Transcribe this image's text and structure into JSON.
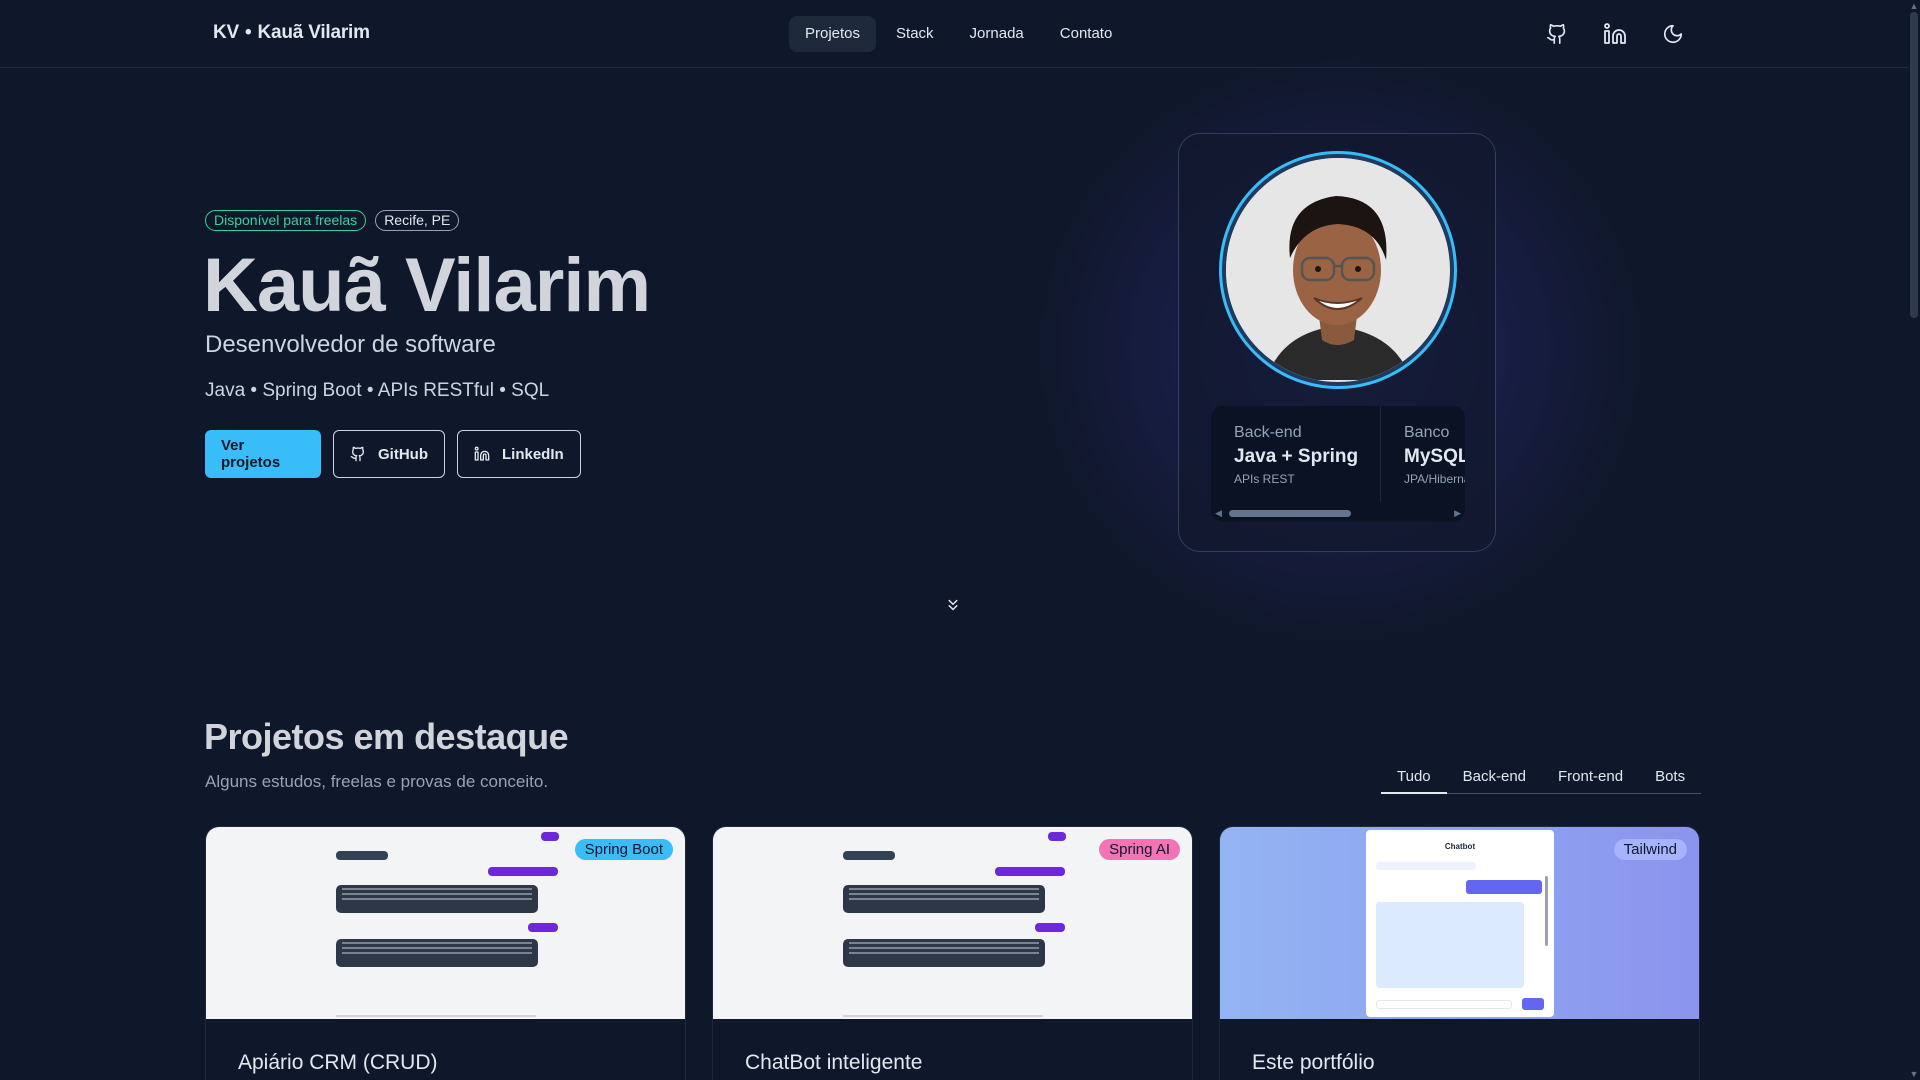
{
  "header": {
    "brand_initials": "KV",
    "brand_sep": "•",
    "brand_name": "Kauã Vilarim",
    "nav": [
      "Projetos",
      "Stack",
      "Jornada",
      "Contato"
    ],
    "icons": [
      "github-icon",
      "linkedin-icon",
      "moon-icon"
    ]
  },
  "hero": {
    "badge_available": "Disponível para freelas",
    "badge_location": "Recife, PE",
    "name": "Kauã Vilarim",
    "role": "Desenvolvedor de software",
    "stack": "Java • Spring Boot • APIs RESTful • SQL",
    "btn_projects": "Ver projetos",
    "btn_github": "GitHub",
    "btn_linkedin": "LinkedIn"
  },
  "profile": {
    "skills": [
      {
        "category": "Back-end",
        "value": "Java + Spring",
        "sub": "APIs REST"
      },
      {
        "category": "Banco",
        "value": "MySQL",
        "sub": "JPA/Hibernate"
      }
    ]
  },
  "projects": {
    "title": "Projetos em destaque",
    "subtitle": "Alguns estudos, freelas e provas de conceito.",
    "filters": [
      "Tudo",
      "Back-end",
      "Front-end",
      "Bots"
    ],
    "active_filter": "Tudo",
    "cards": [
      {
        "title": "Apiário CRM (CRUD)",
        "tag": "Spring Boot"
      },
      {
        "title": "ChatBot inteligente",
        "tag": "Spring AI"
      },
      {
        "title": "Este portfólio",
        "tag": "Tailwind",
        "thumb_heading": "Chatbot"
      }
    ]
  },
  "colors": {
    "background": "#0f172a",
    "accent": "#38bdf8",
    "available": "#34d399",
    "spring_ai_tag": "#f472b6",
    "tailwind_tag": "#a5b4fc"
  }
}
